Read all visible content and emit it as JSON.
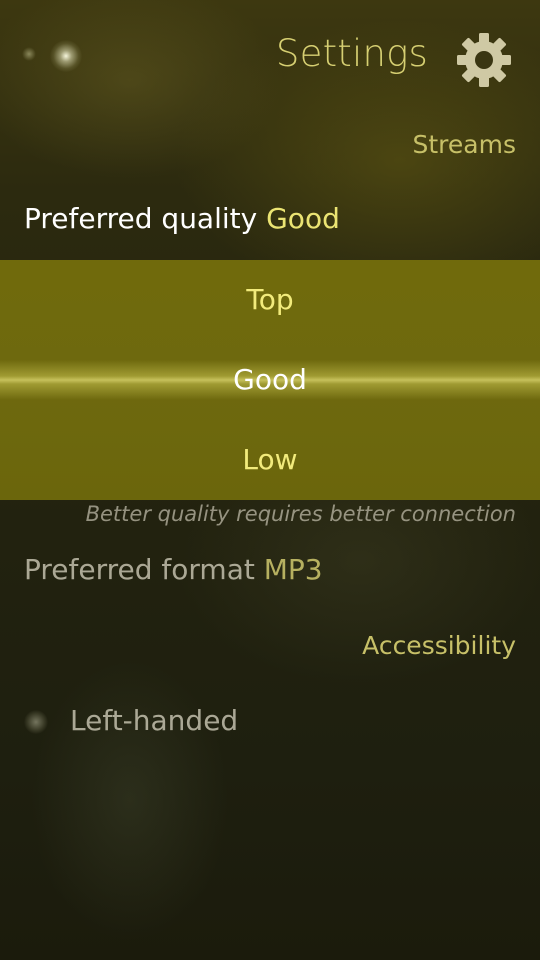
{
  "header": {
    "title": "Settings",
    "icon": "gear-icon"
  },
  "sections": {
    "streams": "Streams",
    "accessibility": "Accessibility"
  },
  "quality": {
    "label": "Preferred quality",
    "value": "Good",
    "options": [
      "Top",
      "Good",
      "Low"
    ],
    "selected": "Good",
    "description": "Better quality requires better connection"
  },
  "format": {
    "label": "Preferred format",
    "value": "MP3"
  },
  "left_handed": {
    "label": "Left-handed",
    "checked": false
  },
  "colors": {
    "accent": "#d6cf72",
    "highlight": "#ebe473",
    "menu_background": "#6e690e"
  }
}
